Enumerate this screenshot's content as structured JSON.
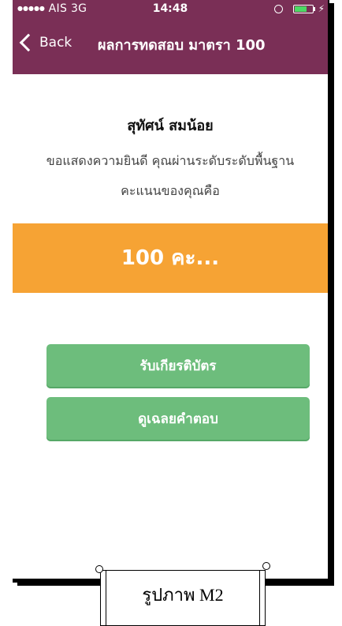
{
  "status_bar": {
    "carrier": "AIS",
    "network": "3G",
    "time": "14:48",
    "signal_dots": "●●●●●"
  },
  "navbar": {
    "back_label": "Back",
    "title": "ผลการทดสอบ มาตรา 100"
  },
  "result": {
    "student_name": "สุทัศน์ สมน้อย",
    "congrats_line1": "ขอแสดงความยินดี คุณผ่านระดับระดับพื้นฐาน",
    "congrats_line2": "คะแนนของคุณคือ",
    "score": "100 คะ..."
  },
  "buttons": {
    "certificate": "รับเกียรติบัตร",
    "view_answers": "ดูเฉลยคำตอบ"
  },
  "caption": {
    "text": "รูปภาพ M2"
  },
  "colors": {
    "header": "#7a2f56",
    "score_band": "#f6a334",
    "button": "#6dbd7c"
  }
}
